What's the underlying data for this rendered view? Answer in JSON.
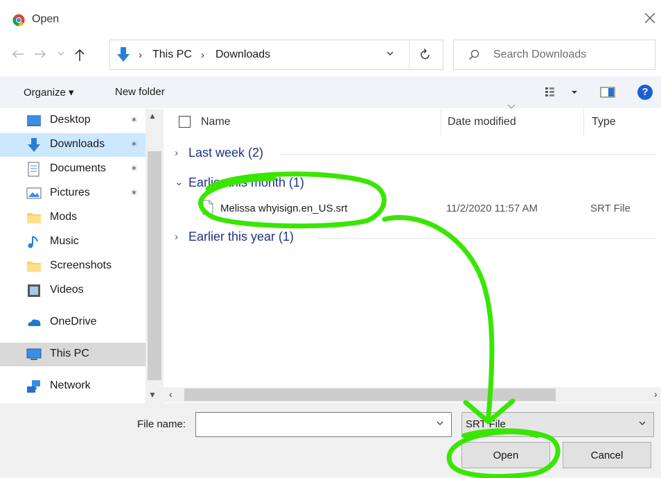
{
  "window": {
    "title": "Open",
    "close_glyph": "✕"
  },
  "address": {
    "separator": "›",
    "crumbs": [
      "This PC",
      "Downloads"
    ],
    "dropdown_glyph": "⌄",
    "refresh_glyph": "↻"
  },
  "search": {
    "placeholder": "Search Downloads"
  },
  "toolbar": {
    "organize_label": "Organize ▾",
    "new_folder_label": "New folder",
    "help_glyph": "?"
  },
  "nav": {
    "pin_glyph": "✶",
    "items": [
      {
        "label": "Desktop",
        "icon": "desktop-icon",
        "pinned": true
      },
      {
        "label": "Downloads",
        "icon": "downloads-icon",
        "pinned": true,
        "selected": true
      },
      {
        "label": "Documents",
        "icon": "documents-icon",
        "pinned": true
      },
      {
        "label": "Pictures",
        "icon": "pictures-icon",
        "pinned": true
      },
      {
        "label": "Mods",
        "icon": "folder-icon",
        "pinned": false
      },
      {
        "label": "Music",
        "icon": "music-icon",
        "pinned": false
      },
      {
        "label": "Screenshots",
        "icon": "folder-icon",
        "pinned": false
      },
      {
        "label": "Videos",
        "icon": "videos-icon",
        "pinned": false
      },
      {
        "label": "OneDrive",
        "icon": "onedrive-icon",
        "pinned": false
      },
      {
        "label": "This PC",
        "icon": "this-pc-icon",
        "pinned": false,
        "highlighted": true
      },
      {
        "label": "Network",
        "icon": "network-icon",
        "pinned": false
      }
    ]
  },
  "columns": {
    "name": "Name",
    "date": "Date modified",
    "type": "Type"
  },
  "groups": [
    {
      "label": "Last week (2)",
      "expanded": false
    },
    {
      "label": "Earlier this month (1)",
      "expanded": true
    },
    {
      "label": "Earlier this year (1)",
      "expanded": false
    }
  ],
  "files": [
    {
      "name": "Melissa whyisign.en_US.srt",
      "date": "11/2/2020 11:57 AM",
      "type": "SRT File"
    }
  ],
  "bottom": {
    "file_name_label": "File name:",
    "file_name_value": "",
    "file_type_value": "SRT File",
    "open_label": "Open",
    "cancel_label": "Cancel"
  },
  "colors": {
    "accent": "#1760d6",
    "annotation": "#39e600",
    "group_text": "#1e3287"
  }
}
